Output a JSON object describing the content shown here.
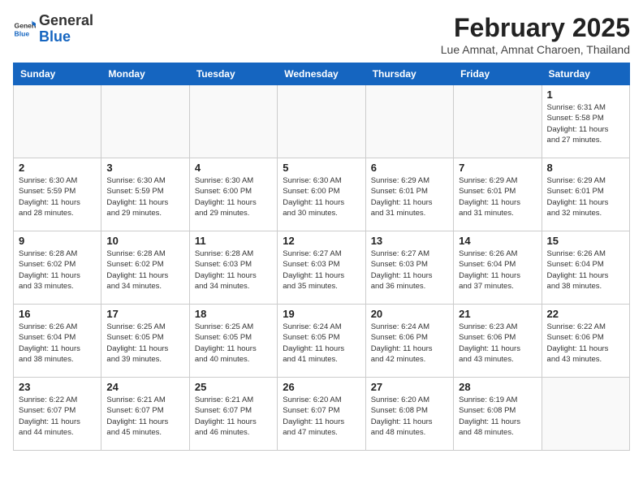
{
  "header": {
    "logo_general": "General",
    "logo_blue": "Blue",
    "month_title": "February 2025",
    "location": "Lue Amnat, Amnat Charoen, Thailand"
  },
  "days_of_week": [
    "Sunday",
    "Monday",
    "Tuesday",
    "Wednesday",
    "Thursday",
    "Friday",
    "Saturday"
  ],
  "weeks": [
    [
      {
        "day": "",
        "info": ""
      },
      {
        "day": "",
        "info": ""
      },
      {
        "day": "",
        "info": ""
      },
      {
        "day": "",
        "info": ""
      },
      {
        "day": "",
        "info": ""
      },
      {
        "day": "",
        "info": ""
      },
      {
        "day": "1",
        "info": "Sunrise: 6:31 AM\nSunset: 5:58 PM\nDaylight: 11 hours\nand 27 minutes."
      }
    ],
    [
      {
        "day": "2",
        "info": "Sunrise: 6:30 AM\nSunset: 5:59 PM\nDaylight: 11 hours\nand 28 minutes."
      },
      {
        "day": "3",
        "info": "Sunrise: 6:30 AM\nSunset: 5:59 PM\nDaylight: 11 hours\nand 29 minutes."
      },
      {
        "day": "4",
        "info": "Sunrise: 6:30 AM\nSunset: 6:00 PM\nDaylight: 11 hours\nand 29 minutes."
      },
      {
        "day": "5",
        "info": "Sunrise: 6:30 AM\nSunset: 6:00 PM\nDaylight: 11 hours\nand 30 minutes."
      },
      {
        "day": "6",
        "info": "Sunrise: 6:29 AM\nSunset: 6:01 PM\nDaylight: 11 hours\nand 31 minutes."
      },
      {
        "day": "7",
        "info": "Sunrise: 6:29 AM\nSunset: 6:01 PM\nDaylight: 11 hours\nand 31 minutes."
      },
      {
        "day": "8",
        "info": "Sunrise: 6:29 AM\nSunset: 6:01 PM\nDaylight: 11 hours\nand 32 minutes."
      }
    ],
    [
      {
        "day": "9",
        "info": "Sunrise: 6:28 AM\nSunset: 6:02 PM\nDaylight: 11 hours\nand 33 minutes."
      },
      {
        "day": "10",
        "info": "Sunrise: 6:28 AM\nSunset: 6:02 PM\nDaylight: 11 hours\nand 34 minutes."
      },
      {
        "day": "11",
        "info": "Sunrise: 6:28 AM\nSunset: 6:03 PM\nDaylight: 11 hours\nand 34 minutes."
      },
      {
        "day": "12",
        "info": "Sunrise: 6:27 AM\nSunset: 6:03 PM\nDaylight: 11 hours\nand 35 minutes."
      },
      {
        "day": "13",
        "info": "Sunrise: 6:27 AM\nSunset: 6:03 PM\nDaylight: 11 hours\nand 36 minutes."
      },
      {
        "day": "14",
        "info": "Sunrise: 6:26 AM\nSunset: 6:04 PM\nDaylight: 11 hours\nand 37 minutes."
      },
      {
        "day": "15",
        "info": "Sunrise: 6:26 AM\nSunset: 6:04 PM\nDaylight: 11 hours\nand 38 minutes."
      }
    ],
    [
      {
        "day": "16",
        "info": "Sunrise: 6:26 AM\nSunset: 6:04 PM\nDaylight: 11 hours\nand 38 minutes."
      },
      {
        "day": "17",
        "info": "Sunrise: 6:25 AM\nSunset: 6:05 PM\nDaylight: 11 hours\nand 39 minutes."
      },
      {
        "day": "18",
        "info": "Sunrise: 6:25 AM\nSunset: 6:05 PM\nDaylight: 11 hours\nand 40 minutes."
      },
      {
        "day": "19",
        "info": "Sunrise: 6:24 AM\nSunset: 6:05 PM\nDaylight: 11 hours\nand 41 minutes."
      },
      {
        "day": "20",
        "info": "Sunrise: 6:24 AM\nSunset: 6:06 PM\nDaylight: 11 hours\nand 42 minutes."
      },
      {
        "day": "21",
        "info": "Sunrise: 6:23 AM\nSunset: 6:06 PM\nDaylight: 11 hours\nand 43 minutes."
      },
      {
        "day": "22",
        "info": "Sunrise: 6:22 AM\nSunset: 6:06 PM\nDaylight: 11 hours\nand 43 minutes."
      }
    ],
    [
      {
        "day": "23",
        "info": "Sunrise: 6:22 AM\nSunset: 6:07 PM\nDaylight: 11 hours\nand 44 minutes."
      },
      {
        "day": "24",
        "info": "Sunrise: 6:21 AM\nSunset: 6:07 PM\nDaylight: 11 hours\nand 45 minutes."
      },
      {
        "day": "25",
        "info": "Sunrise: 6:21 AM\nSunset: 6:07 PM\nDaylight: 11 hours\nand 46 minutes."
      },
      {
        "day": "26",
        "info": "Sunrise: 6:20 AM\nSunset: 6:07 PM\nDaylight: 11 hours\nand 47 minutes."
      },
      {
        "day": "27",
        "info": "Sunrise: 6:20 AM\nSunset: 6:08 PM\nDaylight: 11 hours\nand 48 minutes."
      },
      {
        "day": "28",
        "info": "Sunrise: 6:19 AM\nSunset: 6:08 PM\nDaylight: 11 hours\nand 48 minutes."
      },
      {
        "day": "",
        "info": ""
      }
    ]
  ]
}
